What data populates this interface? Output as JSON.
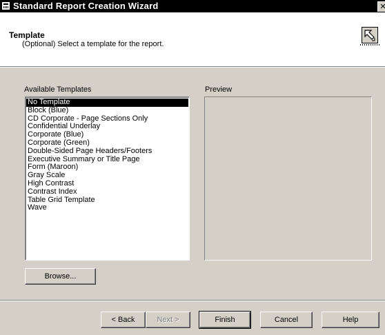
{
  "window": {
    "title": "Standard Report Creation Wizard",
    "close_glyph": "✕"
  },
  "header": {
    "title": "Template",
    "subtitle": "(Optional) Select a template for the report.",
    "icon": "wizard-arrow-icon"
  },
  "available_label": "Available Templates",
  "preview_label": "Preview",
  "templates": {
    "selected_index": 0,
    "items": [
      "No Template",
      "Block (Blue)",
      "CD Corporate - Page Sections Only",
      "Confidential Underlay",
      "Corporate (Blue)",
      "Corporate (Green)",
      "Double-Sided Page Headers/Footers",
      "Executive Summary or Title Page",
      "Form (Maroon)",
      "Gray Scale",
      "High Contrast",
      "Contrast Index",
      "Table Grid Template",
      "Wave"
    ]
  },
  "buttons": {
    "browse": "Browse...",
    "back": "< Back",
    "next": "Next >",
    "finish": "Finish",
    "cancel": "Cancel",
    "help": "Help"
  }
}
